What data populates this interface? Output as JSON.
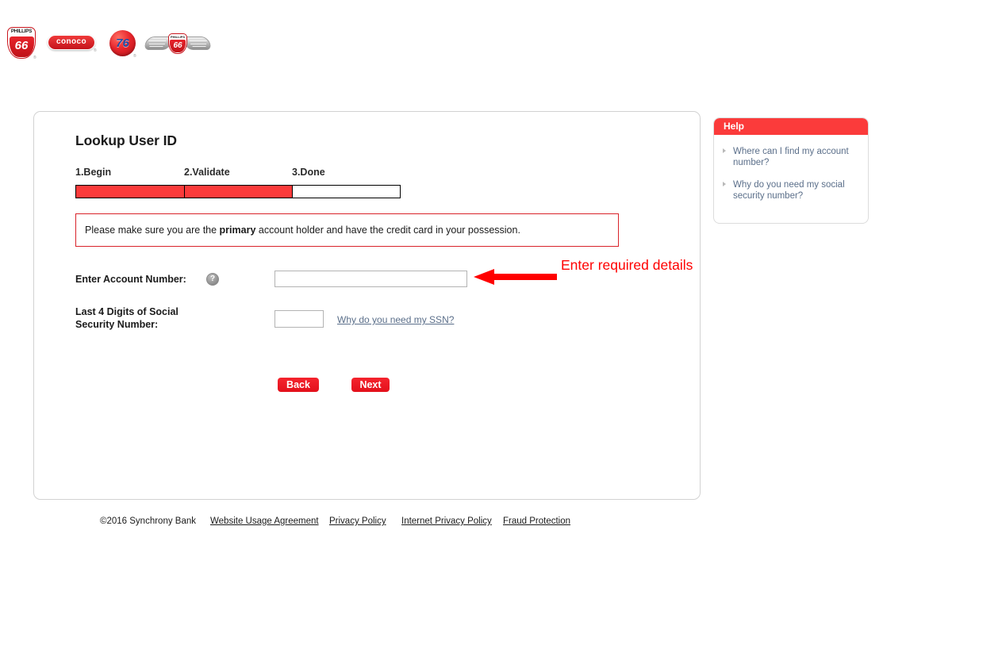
{
  "brand_bar": {
    "logos": [
      {
        "name": "phillips-66-logo",
        "top_text": "PHILLIPS",
        "bottom_text": "66"
      },
      {
        "name": "conoco-logo",
        "text": "conoco"
      },
      {
        "name": "union-76-logo",
        "text": "76"
      },
      {
        "name": "wings-66-logo",
        "top_text": "PHILLIPS",
        "bottom_text": "66"
      }
    ]
  },
  "card": {
    "title": "Lookup User ID",
    "steps": [
      {
        "label": "1.Begin",
        "state": "done"
      },
      {
        "label": "2.Validate",
        "state": "done"
      },
      {
        "label": "3.Done",
        "state": "todo"
      }
    ],
    "notice": {
      "text_before": "Please make sure you are the ",
      "text_bold": "primary",
      "text_after": " account holder and have the credit card in your possession."
    },
    "form": {
      "account_label": "Enter Account Number:",
      "account_help_icon": "?",
      "account_value": "",
      "account_placeholder": "",
      "ssn_label": "Last 4 Digits of Social Security Number:",
      "ssn_value": "",
      "ssn_placeholder": "",
      "ssn_help_link": "Why do you need my SSN?"
    },
    "buttons": {
      "back": "Back",
      "next": "Next"
    }
  },
  "annotation": {
    "text": "Enter required details",
    "color": "#ff0000"
  },
  "help_panel": {
    "header": "Help",
    "links": [
      "Where can I find my account number?",
      "Why do you need my social security number?"
    ]
  },
  "footer": {
    "copyright": "©2016 Synchrony Bank",
    "links": [
      "Website Usage Agreement",
      "Privacy Policy",
      "Internet Privacy Policy",
      "Fraud Protection"
    ]
  },
  "colors": {
    "brand_red": "#fb3b3b",
    "button_red": "#e3101b",
    "notice_border": "#d9232a",
    "link_blue": "#5b6f8a",
    "annotation_red": "#ff0000"
  }
}
